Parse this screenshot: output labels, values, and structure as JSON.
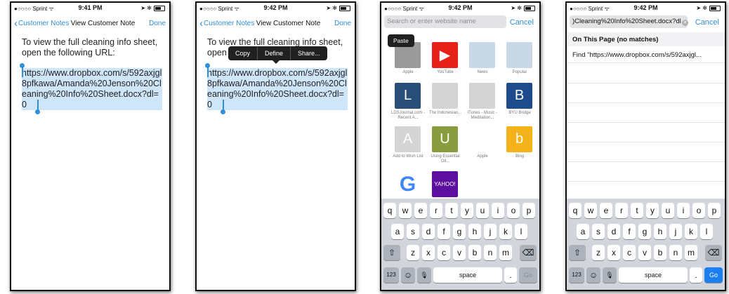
{
  "status": {
    "carrier": "●○○○○ Sprint ᯤ",
    "indicators": "➤ ✻",
    "times": [
      "9:41 PM",
      "9:42 PM",
      "9:42 PM",
      "9:42 PM"
    ]
  },
  "note": {
    "back_label": "Customer Notes",
    "title": "View Customer Note",
    "done_label": "Done",
    "intro": "To view the full cleaning info sheet, open the following URL:",
    "intro_partial": "To view the full cleaning info sheet,",
    "intro_partial2": "open",
    "url": "https://www.dropbox.com/s/592axjgl8pfkawa/Amanda%20Jenson%20Cleaning%20Info%20Sheet.docx?dl=0"
  },
  "edit_menu": {
    "copy": "Copy",
    "define": "Define",
    "share": "Share..."
  },
  "safari": {
    "placeholder": "Search or enter website name",
    "cancel": "Cancel",
    "paste": "Paste",
    "favorites": [
      {
        "label": "Apple",
        "letter": "",
        "color": "#9a9a9a"
      },
      {
        "label": "YouTube",
        "letter": "▶",
        "color": "#e62117"
      },
      {
        "label": "News",
        "letter": "",
        "color": "#c8d8e6"
      },
      {
        "label": "Popular",
        "letter": "",
        "color": "#c8d8e6"
      },
      {
        "label": "LDSJournal.com - Recent A...",
        "letter": "L",
        "color": "#294f78"
      },
      {
        "label": "The Indonesian...",
        "letter": "",
        "color": "#d4d4d4"
      },
      {
        "label": "iTunes - Music - Meditation...",
        "letter": "",
        "color": "#d4d4d4"
      },
      {
        "label": "BYU Bridge",
        "letter": "B",
        "color": "#1e4b8c"
      },
      {
        "label": "Add to Wish List",
        "letter": "A",
        "color": "#d4d4d4"
      },
      {
        "label": "Using Essential Oil...",
        "letter": "U",
        "color": "#8a9d3e"
      },
      {
        "label": "Apple",
        "letter": "",
        "color": "#ffffff"
      },
      {
        "label": "Bing",
        "letter": "b",
        "color": "#f4b21a"
      },
      {
        "label": "",
        "letter": "G",
        "color": "#ffffff"
      },
      {
        "label": "",
        "letter": "YAHOO!",
        "color": "#5c0f9e"
      }
    ]
  },
  "find": {
    "url_field": ")Cleaning%20Info%20Sheet.docx?dl",
    "cancel": "Cancel",
    "section": "On This Page (no matches)",
    "find_row": "Find \"https://www.dropbox.com/s/592axjgl..."
  },
  "keyboard": {
    "row1": [
      "q",
      "w",
      "e",
      "r",
      "t",
      "y",
      "u",
      "i",
      "o",
      "p"
    ],
    "row2": [
      "a",
      "s",
      "d",
      "f",
      "g",
      "h",
      "j",
      "k",
      "l"
    ],
    "row3": [
      "z",
      "x",
      "c",
      "v",
      "b",
      "n",
      "m"
    ],
    "shift": "⇧",
    "delete": "⌫",
    "num": "123",
    "emoji": "☺",
    "mic": "🎙",
    "space": "space",
    "period": ".",
    "go": "Go"
  },
  "colors": {
    "accent": "#2f8fd8",
    "selection": "#cfe6fa",
    "go_active": "#1a7ef5"
  }
}
